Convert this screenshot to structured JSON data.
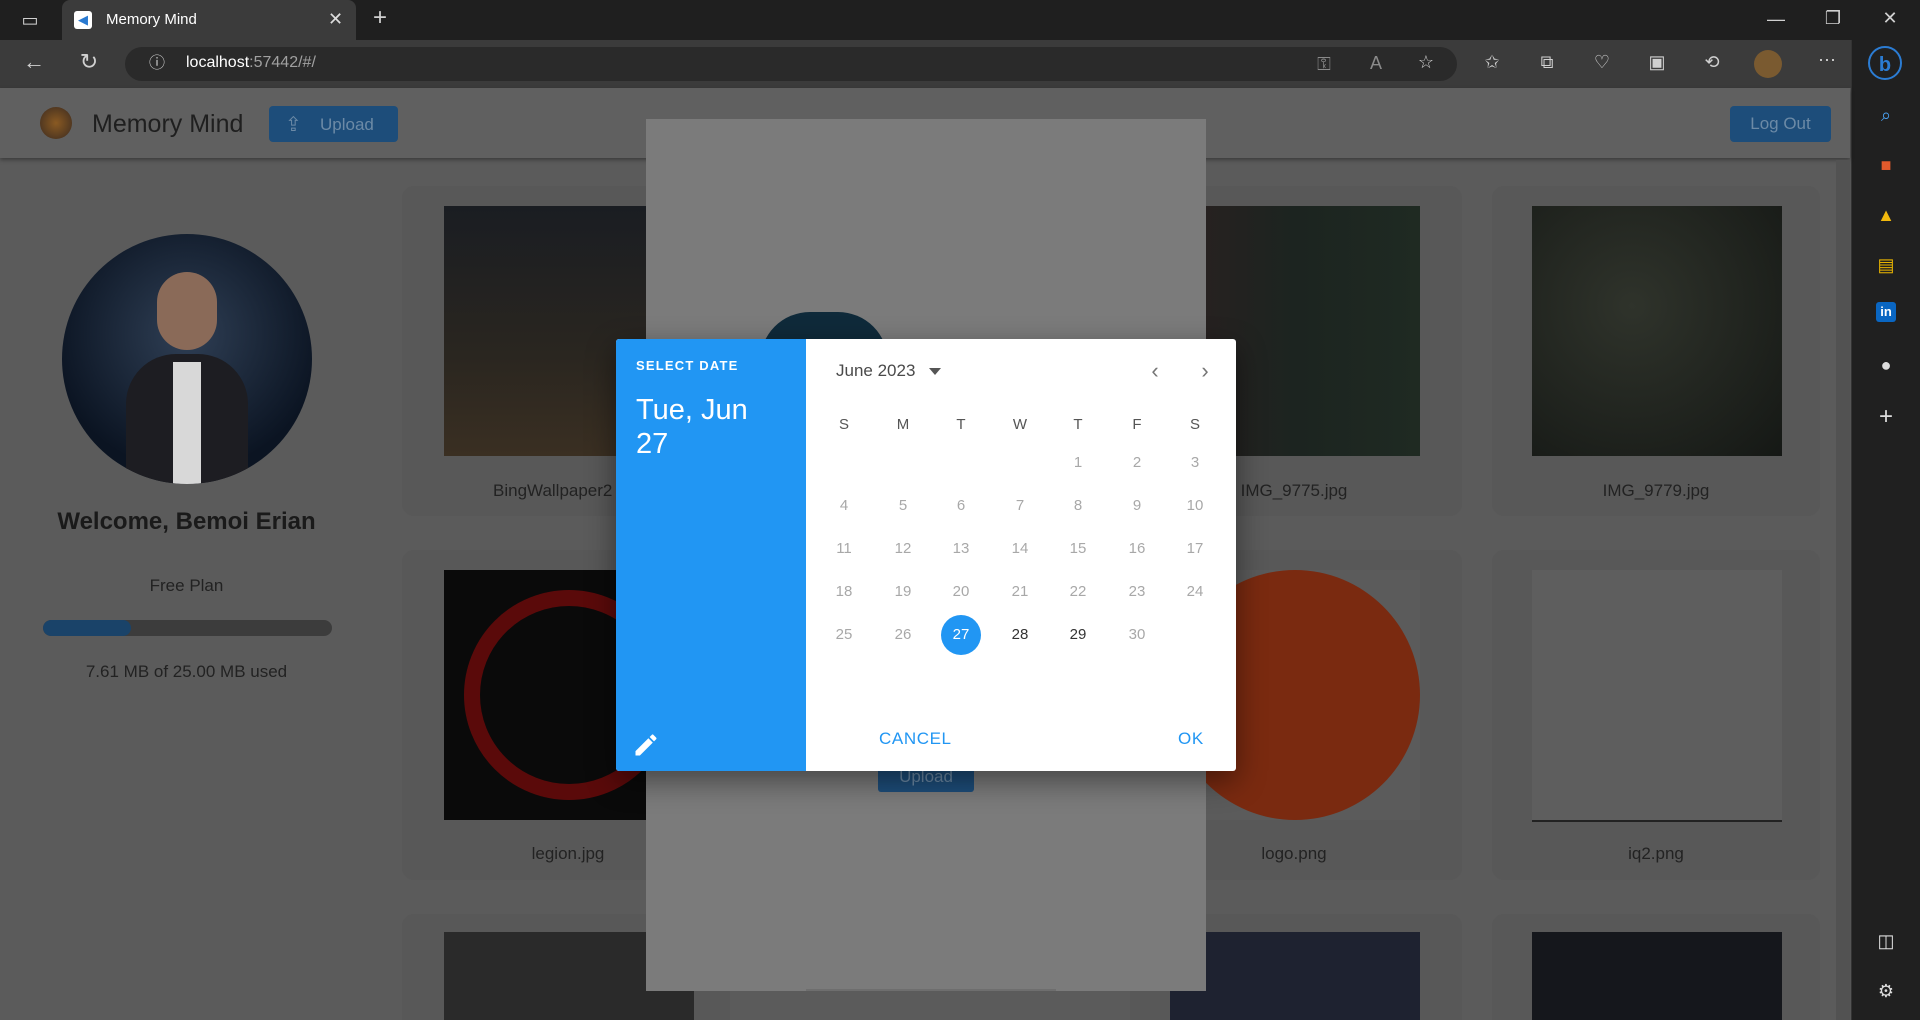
{
  "browser": {
    "tab_title": "Memory Mind",
    "url_host": "localhost",
    "url_rest": ":57442/#/"
  },
  "app": {
    "title": "Memory Mind",
    "upload_label": "Upload",
    "logout_label": "Log Out"
  },
  "profile": {
    "welcome": "Welcome, Bemoi Erian",
    "plan": "Free Plan",
    "usage_text": "7.61 MB of 25.00 MB used",
    "usage_fraction": 0.304
  },
  "gallery": {
    "items": [
      {
        "name": "BingWallpaper2"
      },
      {
        "name": "IMG_9775.jpg"
      },
      {
        "name": "IMG_9779.jpg"
      },
      {
        "name": "legion.jpg"
      },
      {
        "name": "logo.png"
      },
      {
        "name": "iq2.png"
      }
    ]
  },
  "modal": {
    "upload_label": "Upload"
  },
  "datepicker": {
    "header_label": "SELECT DATE",
    "selected_line1": "Tue, Jun",
    "selected_line2": "27",
    "month_label": "June 2023",
    "weekdays": [
      "S",
      "M",
      "T",
      "W",
      "T",
      "F",
      "S"
    ],
    "days": [
      "1",
      "2",
      "3",
      "4",
      "5",
      "6",
      "7",
      "8",
      "9",
      "10",
      "11",
      "12",
      "13",
      "14",
      "15",
      "16",
      "17",
      "18",
      "19",
      "20",
      "21",
      "22",
      "23",
      "24",
      "25",
      "26",
      "27",
      "28",
      "29",
      "30"
    ],
    "selected_day": "27",
    "enabled_days": [
      "28",
      "29"
    ],
    "cancel_label": "CANCEL",
    "ok_label": "OK"
  },
  "colors": {
    "accent": "#2196f3",
    "app_button": "#1d4d7a"
  }
}
